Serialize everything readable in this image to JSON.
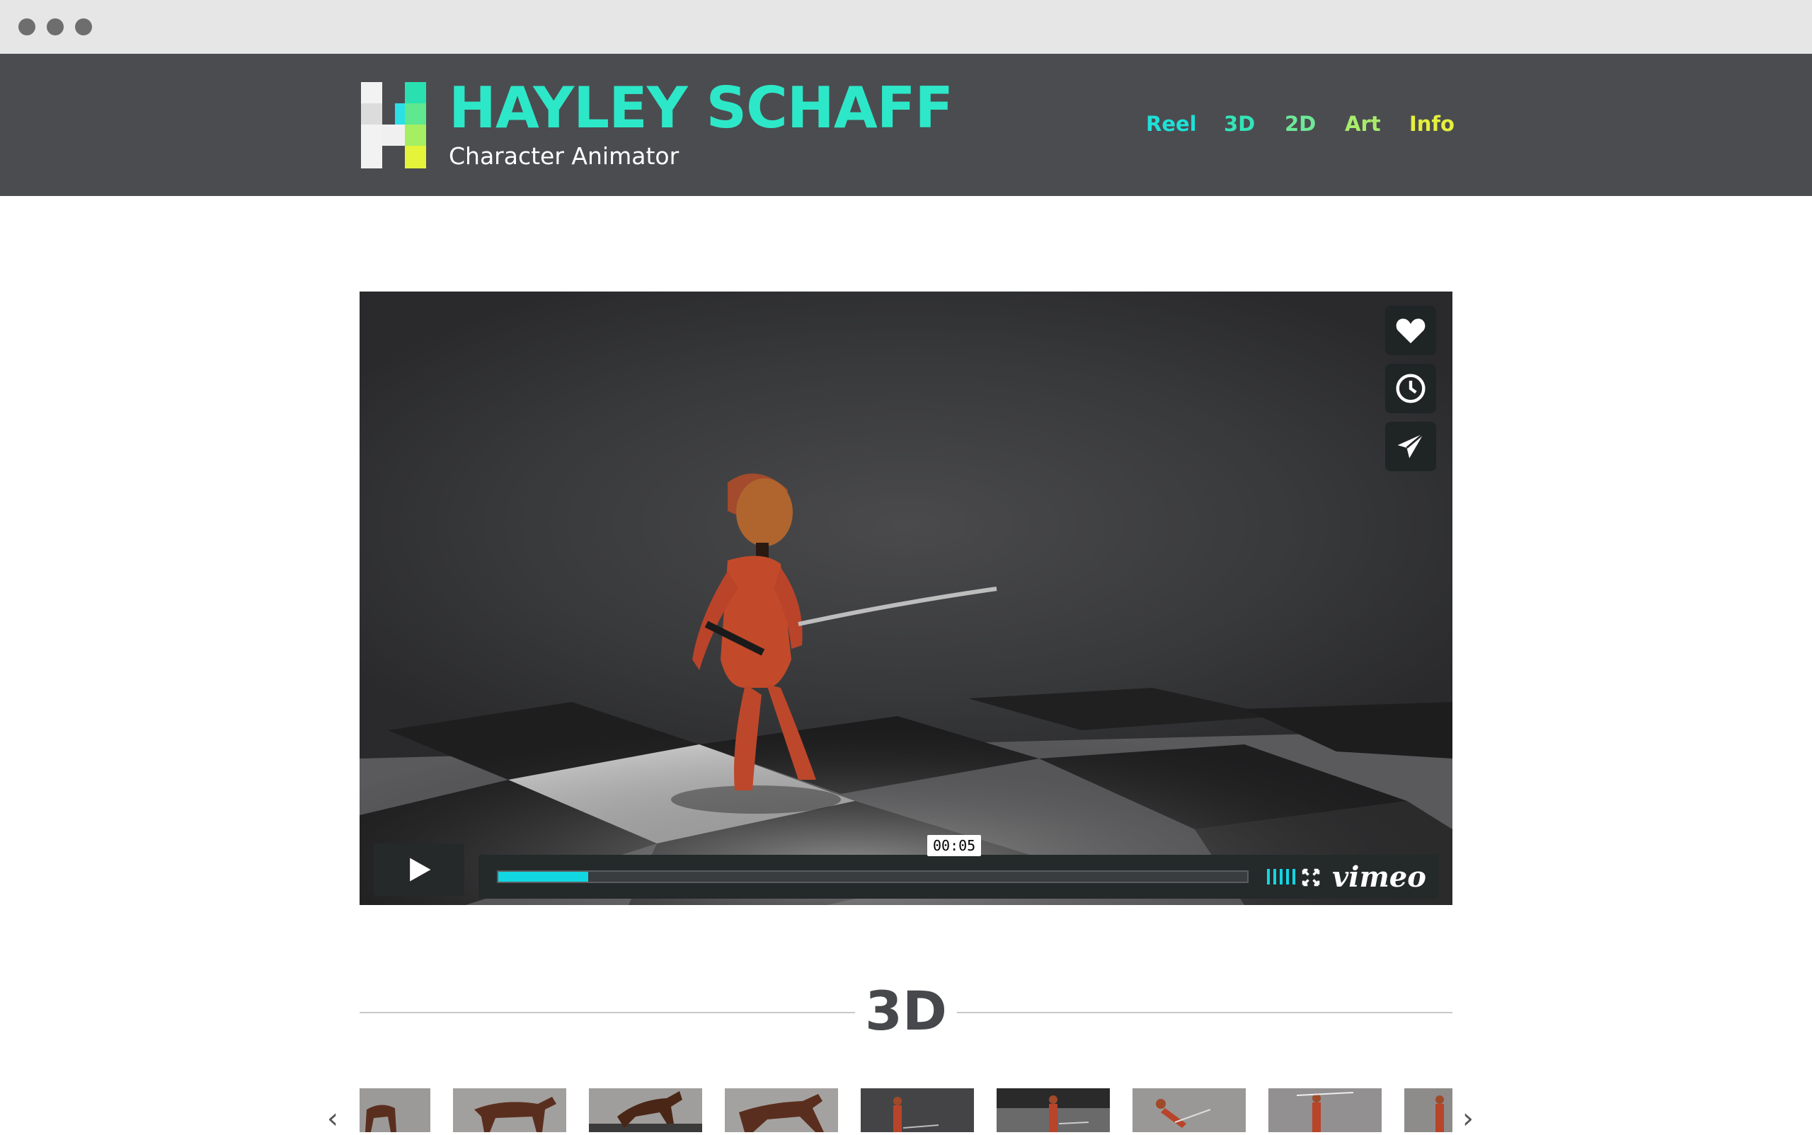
{
  "site": {
    "title": "HAYLEY SCHAFF",
    "subtitle": "Character Animator"
  },
  "nav": [
    {
      "label": "Reel",
      "color": "#1ee0d8"
    },
    {
      "label": "3D",
      "color": "#34e4b8"
    },
    {
      "label": "2D",
      "color": "#6ee898"
    },
    {
      "label": "Art",
      "color": "#a8ec6a"
    },
    {
      "label": "Info",
      "color": "#e4f03c"
    }
  ],
  "video": {
    "time_tooltip": "00:05",
    "progress": 0.12,
    "brand": "vimeo",
    "side_buttons": [
      "heart-icon",
      "clock-icon",
      "send-icon"
    ]
  },
  "section": {
    "title": "3D"
  },
  "thumbnails": [
    "horse-thumbnail-1",
    "horse-thumbnail-2",
    "horse-thumbnail-3",
    "horse-thumbnail-4",
    "character-thumbnail-1",
    "character-thumbnail-2",
    "character-thumbnail-3",
    "character-thumbnail-4",
    "character-thumbnail-5"
  ],
  "colors": {
    "header_bg": "#4b4c50",
    "accent": "#2de8c8",
    "progress": "#13d6e3"
  }
}
